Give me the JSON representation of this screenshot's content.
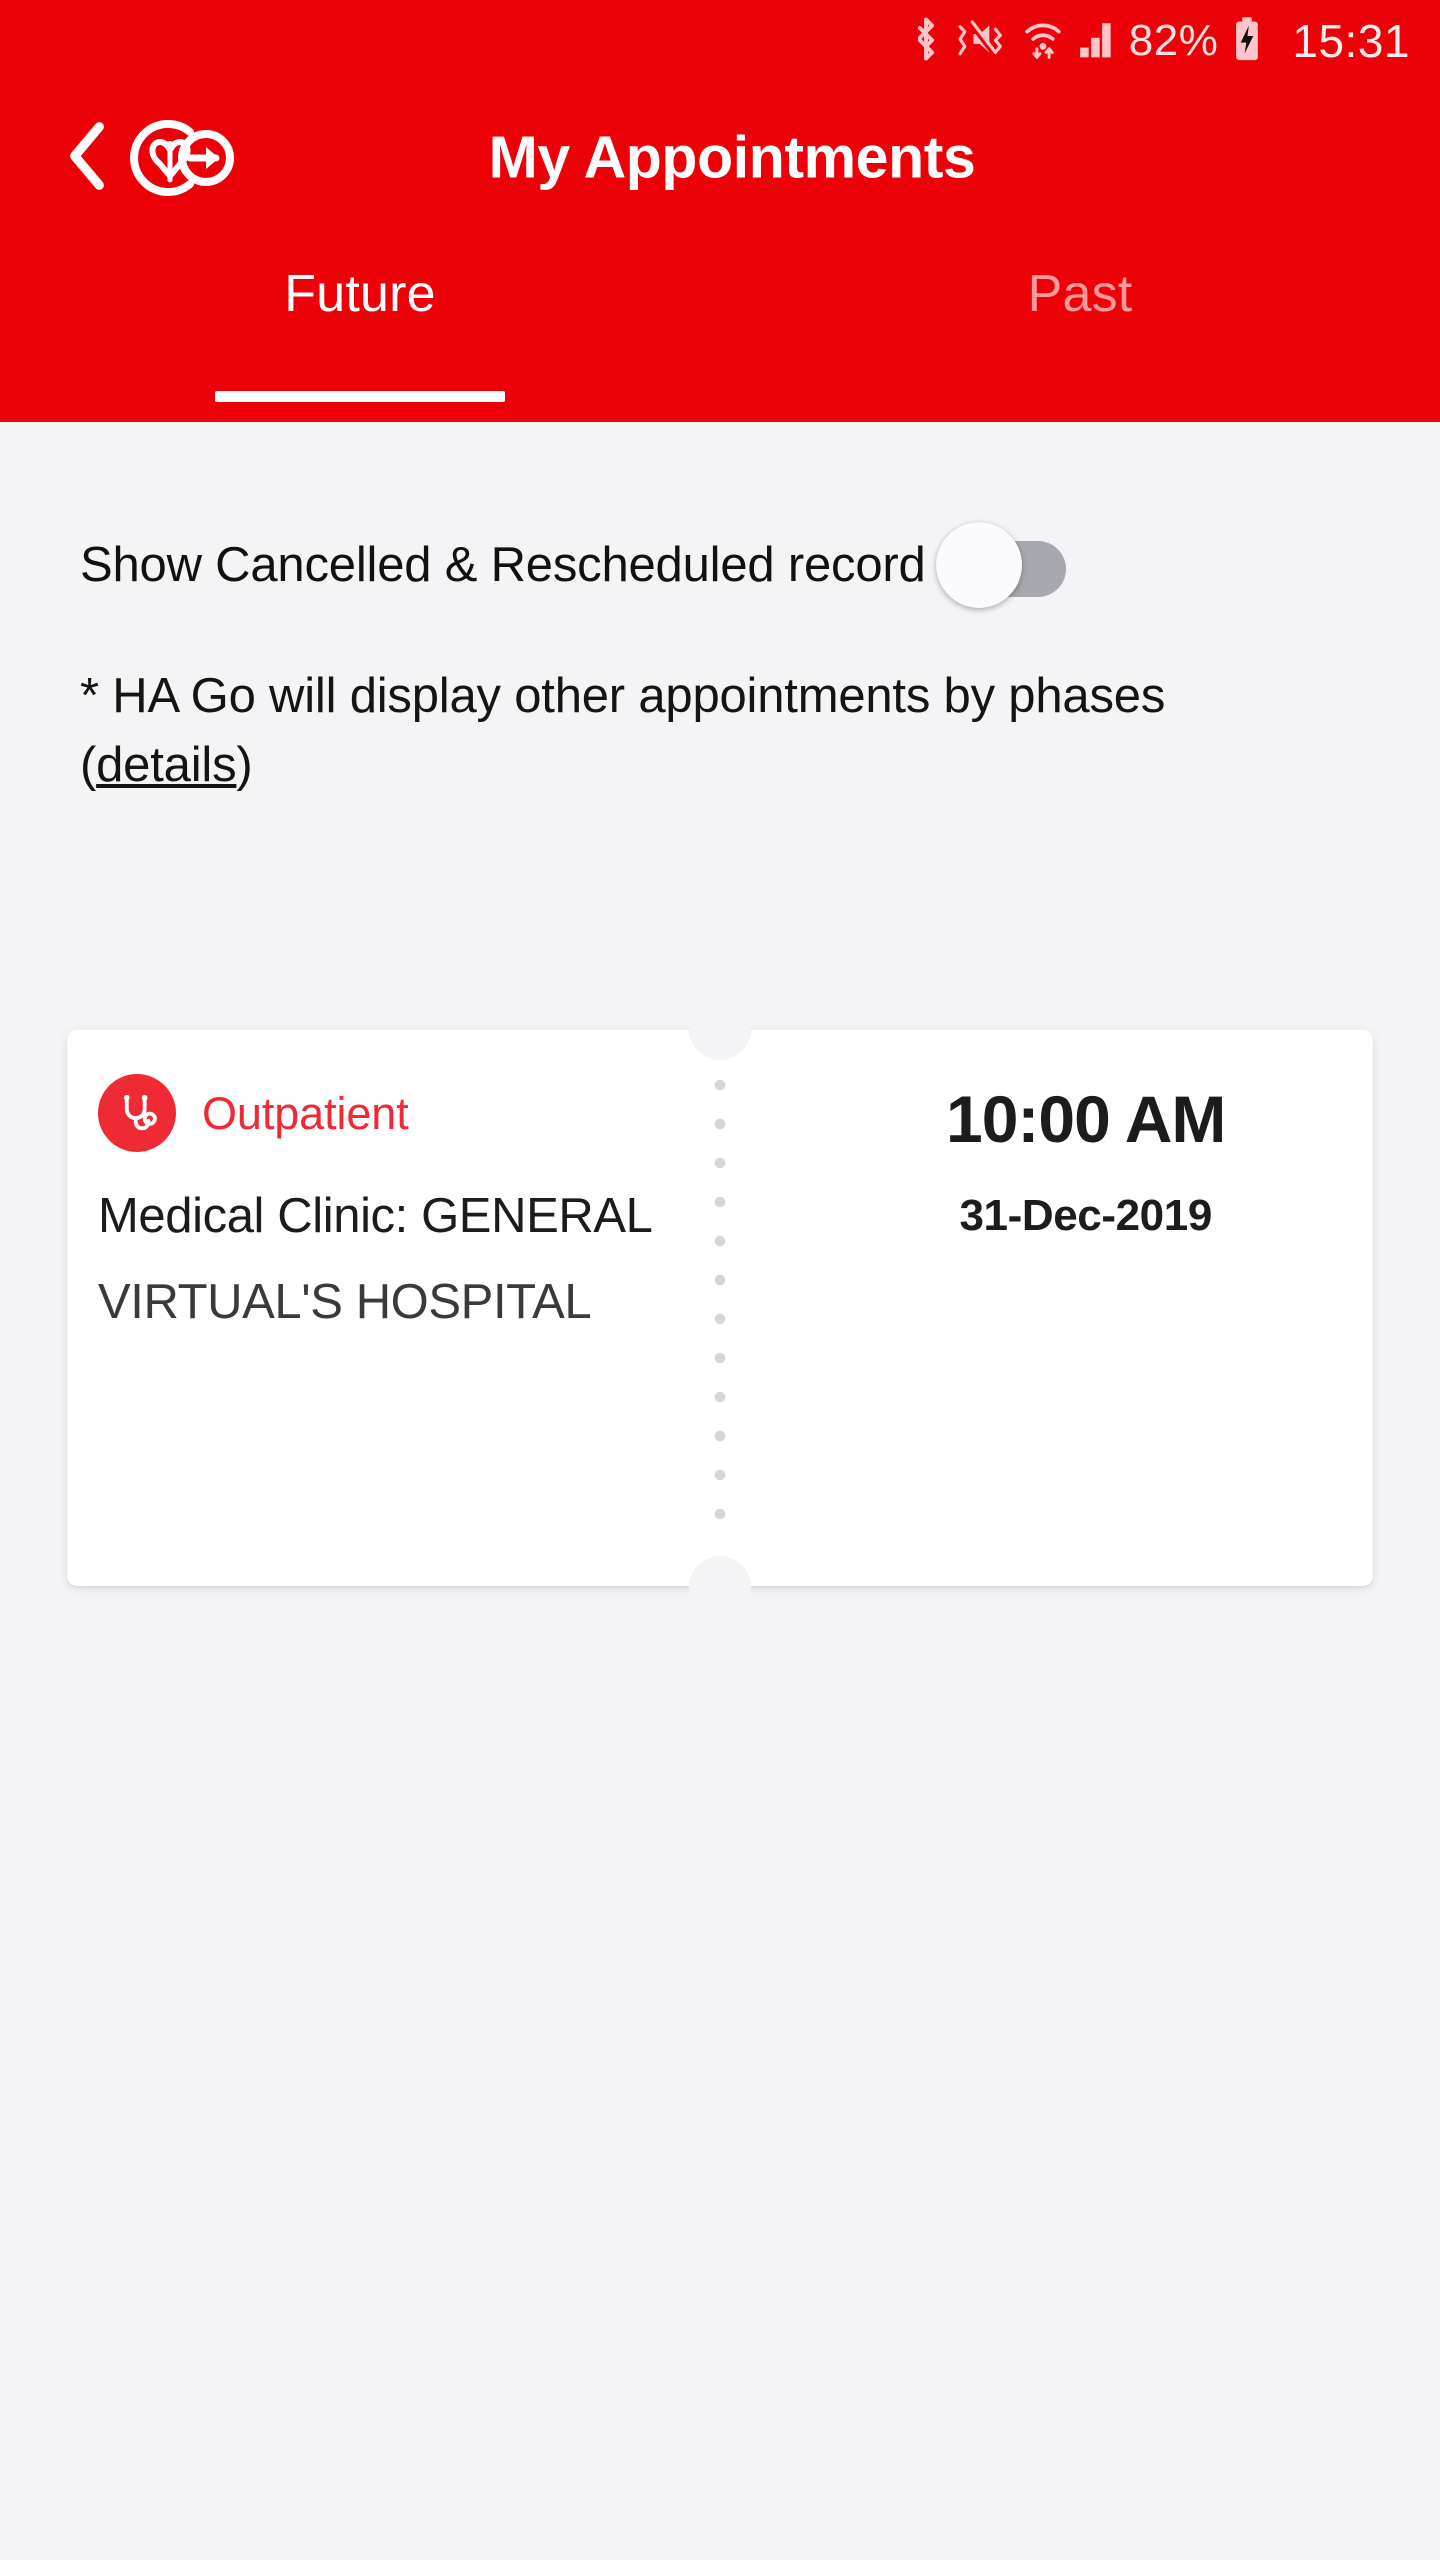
{
  "statusbar": {
    "battery_percent": "82%",
    "clock": "15:31",
    "icons": [
      "bluetooth-icon",
      "mute-vibrate-icon",
      "wifi-icon",
      "cellular-signal-icon",
      "battery-charging-icon"
    ]
  },
  "appbar": {
    "title": "My Appointments",
    "back_icon": "back-chevron-icon",
    "brand_logo": "ha-go-logo",
    "brand_color": "#ED0109"
  },
  "tabs": [
    {
      "label": "Future",
      "active": true
    },
    {
      "label": "Past",
      "active": false
    }
  ],
  "filter": {
    "label": "Show Cancelled & Rescheduled record",
    "toggle_state": "off"
  },
  "note": {
    "prefix": "* HA Go will display other appointments by phases (",
    "link": "details",
    "suffix": ")"
  },
  "appointments": [
    {
      "type_label": "Outpatient",
      "type_icon": "stethoscope-icon",
      "type_color": "#EE2A34",
      "clinic": "Medical Clinic: GENERAL",
      "hospital": "VIRTUAL'S HOSPITAL",
      "time": "10:00 AM",
      "date": "31-Dec-2019"
    }
  ]
}
